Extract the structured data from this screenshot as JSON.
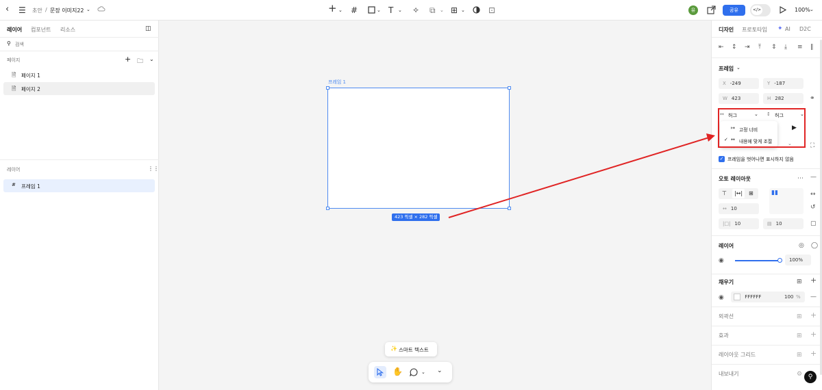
{
  "topbar": {
    "breadcrumb_draft": "초안",
    "breadcrumb_sep": "/",
    "file_name": "문장 이미지22",
    "avatar_initial": "유",
    "share_label": "공유",
    "dev_mode_label": "</>",
    "zoom_label": "100%"
  },
  "left_panel": {
    "tabs": [
      "레이어",
      "컴포넌트",
      "리소스"
    ],
    "search_placeholder": "검색",
    "pages_title": "페이지",
    "pages": [
      "페이지 1",
      "페이지 2"
    ],
    "layers_title": "레이어",
    "layers": [
      "프레임 1"
    ]
  },
  "canvas": {
    "frame_label": "프레임 1",
    "size_badge": "423 픽셀 × 282 픽셀"
  },
  "bottom_toolbar": {
    "smart_text_label": "스마트 텍스트"
  },
  "right_panel": {
    "tabs": [
      "디자인",
      "프로토타입",
      "AI",
      "D2C"
    ],
    "frame_title": "프레임",
    "x": {
      "label": "X",
      "value": "-249"
    },
    "y": {
      "label": "Y",
      "value": "-187"
    },
    "w": {
      "label": "W",
      "value": "423"
    },
    "h": {
      "label": "H",
      "value": "282"
    },
    "width_mode": "허그",
    "height_mode": "허그",
    "width_menu": [
      {
        "label": "고정 너비",
        "checked": false
      },
      {
        "label": "내용에 맞게 조절",
        "checked": true
      }
    ],
    "clip_label": "프레임을 벗어나면 표시하지 않음",
    "auto_layout_title": "오토 레이아웃",
    "gap_value": "10",
    "padding_h": "10",
    "padding_v": "10",
    "layer_title": "레이어",
    "opacity_value": "100%",
    "opacity_fraction": 1.0,
    "fill_title": "채우기",
    "fill_hex": "FFFFFF",
    "fill_opacity": "100",
    "fill_opacity_unit": "%",
    "stroke_title": "외곽선",
    "effect_title": "효과",
    "layout_grid_title": "레이아웃 그리드",
    "export_title": "내보내기"
  },
  "colors": {
    "accent": "#2f6fed",
    "selection": "#4d8af0",
    "annotation": "#e02424",
    "avatar": "#5a9a3c"
  }
}
